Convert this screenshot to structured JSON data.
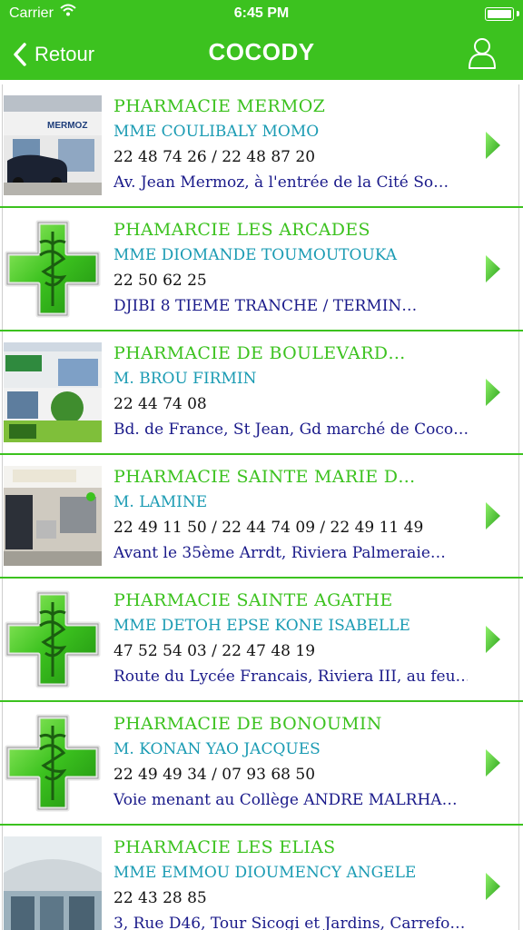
{
  "status_bar": {
    "carrier": "Carrier",
    "time": "6:45 PM"
  },
  "nav": {
    "back_label": "Retour",
    "title": "COCODY"
  },
  "colors": {
    "accent": "#3cc21f",
    "owner": "#1a9bb3",
    "address": "#1a1a8a"
  },
  "pharmacies": [
    {
      "name": "PHARMACIE MERMOZ",
      "owner": "MME COULIBALY MOMO",
      "phone": "22 48 74 26 / 22 48 87 20",
      "address": "Av. Jean Mermoz, à l'entrée de la Cité So…",
      "thumb": "photo-mermoz",
      "sign": "MERMOZ"
    },
    {
      "name": "PHAMARCIE LES ARCADES",
      "owner": "MME DIOMANDE TOUMOUTOUKA",
      "phone": "22 50 62 25",
      "address": "DJIBI 8 TIEME TRANCHE / TERMIN…",
      "thumb": "pharmacy-cross-icon"
    },
    {
      "name": "PHARMACIE DE BOULEVARD…",
      "owner": "M. BROU FIRMIN",
      "phone": "22 44 74 08",
      "address": "Bd. de France, St Jean, Gd marché de Coco…",
      "thumb": "photo-boulevard"
    },
    {
      "name": "PHARMACIE SAINTE MARIE D…",
      "owner": "M. LAMINE",
      "phone": "22 49 11 50 / 22 44 74 09 / 22 49 11 49",
      "address": "Avant le 35ème Arrdt, Riviera Palmeraie…",
      "thumb": "photo-sainte-marie"
    },
    {
      "name": "PHARMACIE SAINTE AGATHE",
      "owner": "MME DETOH EPSE KONE ISABELLE",
      "phone": "47 52 54 03 / 22 47 48 19",
      "address": "Route du Lycée Francais, Riviera III, au feu…",
      "thumb": "pharmacy-cross-icon"
    },
    {
      "name": "PHARMACIE DE BONOUMIN",
      "owner": "M. KONAN YAO JACQUES",
      "phone": "22 49 49 34 / 07 93 68 50",
      "address": "Voie menant au Collège ANDRE MALRHA…",
      "thumb": "pharmacy-cross-icon"
    },
    {
      "name": "PHARMACIE LES ELIAS",
      "owner": "MME EMMOU DIOUMENCY ANGELE",
      "phone": "22 43 28 85",
      "address": "3, Rue D46, Tour Sicogi et Jardins, Carrefo…",
      "thumb": "photo-elias"
    }
  ]
}
